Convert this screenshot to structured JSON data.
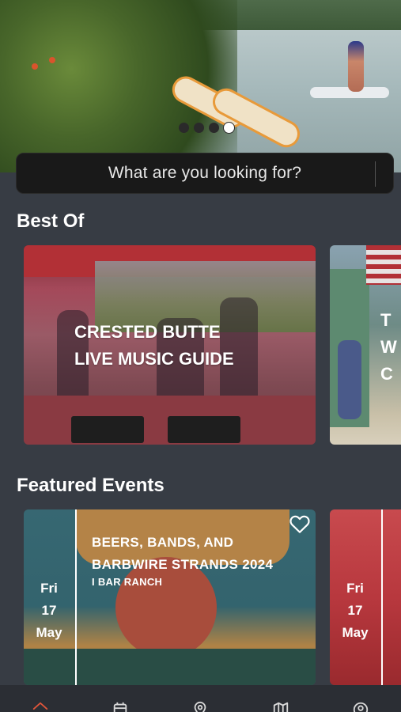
{
  "hero": {
    "carousel_dots": 4,
    "active_dot_index": 3
  },
  "search": {
    "placeholder": "What are you looking for?"
  },
  "best_of": {
    "title": "Best Of",
    "cards": [
      {
        "title_line1": "CRESTED BUTTE",
        "title_line2": "LIVE MUSIC GUIDE"
      },
      {
        "title_line1": "T",
        "title_line2": "W",
        "title_line3": "C"
      }
    ]
  },
  "featured_events": {
    "title": "Featured Events",
    "cards": [
      {
        "title_line1": "BEERS, BANDS, AND",
        "title_line2": "BARBWIRE STRANDS 2024",
        "venue": "I BAR RANCH",
        "day": "Fri",
        "date": "17",
        "month": "May",
        "favorited": false
      },
      {
        "day": "Fri",
        "date": "17",
        "month": "May"
      }
    ]
  },
  "bottom_nav": {
    "items": [
      "home",
      "calendar",
      "location",
      "map",
      "profile"
    ],
    "active": "home",
    "active_color": "#e0553a",
    "inactive_color": "#d8d8d8"
  }
}
